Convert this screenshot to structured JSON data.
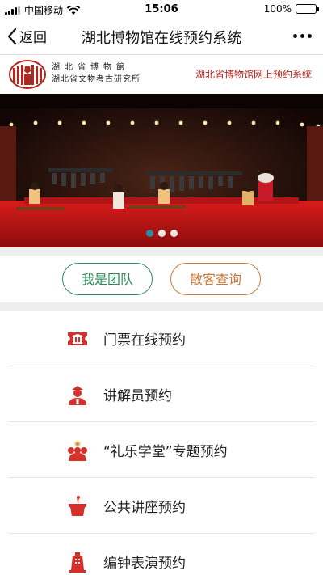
{
  "status_bar": {
    "carrier": "中国移动",
    "time": "15:06",
    "battery": "100%",
    "battery_level": 1.0
  },
  "nav": {
    "back_label": "返回",
    "title": "湖北博物馆在线预约系统"
  },
  "logo": {
    "name_line1": "湖北省博物館",
    "name_line2": "湖北省文物考古研究所",
    "right_text": "湖北省博物馆网上预约系统"
  },
  "banner": {
    "slide_count": 3,
    "active_slide": 1
  },
  "buttons": {
    "team": "我是团队",
    "individual": "散客查询"
  },
  "menu": {
    "items": [
      {
        "label": "门票在线预约",
        "icon": "ticket-icon"
      },
      {
        "label": "讲解员预约",
        "icon": "guide-icon"
      },
      {
        "label": "“礼乐学堂”专题预约",
        "icon": "classroom-icon"
      },
      {
        "label": "公共讲座预约",
        "icon": "lecture-icon"
      },
      {
        "label": "编钟表演预约",
        "icon": "bell-icon"
      }
    ]
  },
  "colors": {
    "accent_red": "#b3261e",
    "green": "#2e8b57",
    "orange": "#c77838",
    "dot_active": "#2a8aa6"
  }
}
